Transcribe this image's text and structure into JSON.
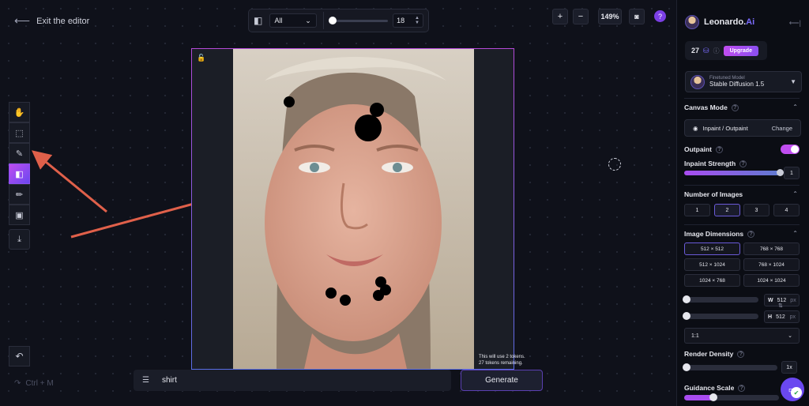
{
  "header": {
    "exit_label": "Exit the editor"
  },
  "toolbar": {
    "mode": "All",
    "brush_size": "18"
  },
  "zoom": {
    "plus": "+",
    "minus": "−",
    "level": "149%"
  },
  "left_tools": [
    "pan-tool",
    "select-tool",
    "brush-tool",
    "eraser-tool",
    "pencil-tool",
    "image-tool",
    "download-tool"
  ],
  "canvas": {
    "token_note_line1": "This will use 2 tokens.",
    "token_note_line2": "27 tokens remaining."
  },
  "prompt": {
    "value": "shirt",
    "generate_label": "Generate"
  },
  "shortcut": {
    "label": "Ctrl + M"
  },
  "panel": {
    "brand_a": "Leonardo.",
    "brand_b": "Ai",
    "tokens": "27",
    "upgrade": "Upgrade",
    "model_caption": "Finetuned Model",
    "model_name": "Stable Diffusion 1.5",
    "canvas_mode_title": "Canvas Mode",
    "canvas_mode_value": "Inpaint / Outpaint",
    "change": "Change",
    "outpaint_label": "Outpaint",
    "inpaint_strength_label": "Inpaint Strength",
    "inpaint_strength_value": "1",
    "num_images_title": "Number of Images",
    "num_images_options": [
      "1",
      "2",
      "3",
      "4"
    ],
    "num_images_selected": 1,
    "dimensions_title": "Image Dimensions",
    "dimensions": [
      "512 × 512",
      "768 × 768",
      "512 × 1024",
      "768 × 1024",
      "1024 × 768",
      "1024 × 1024"
    ],
    "width_label": "W",
    "width_value": "512",
    "height_label": "H",
    "height_value": "512",
    "unit": "px",
    "aspect": "1:1",
    "render_density_title": "Render Density",
    "render_density_value": "1x",
    "guidance_title": "Guidance Scale"
  },
  "colors": {
    "accent": "#c04df0",
    "accent2": "#6a48f0",
    "bg": "#0f111a"
  }
}
